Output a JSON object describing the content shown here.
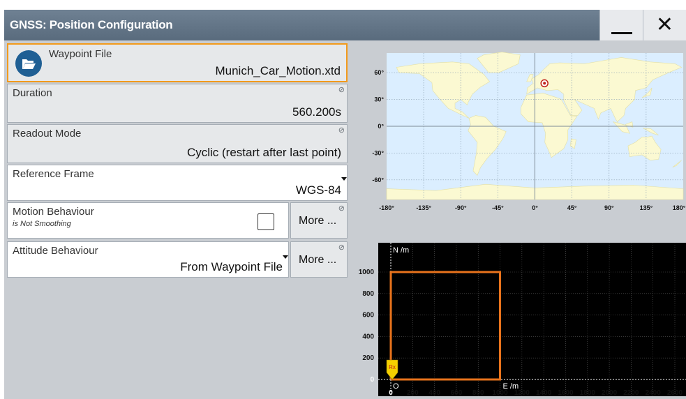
{
  "window": {
    "title": "GNSS: Position Configuration"
  },
  "titlebar": {
    "minimize_icon": "minimize-icon",
    "close_icon": "close-icon",
    "close_glyph": "✕"
  },
  "waypoint": {
    "label": "Waypoint File",
    "value": "Munich_Car_Motion.xtd",
    "icon": "folder-open-icon"
  },
  "duration": {
    "label": "Duration",
    "value": "560.200s",
    "readonly_icon": "read-only-icon"
  },
  "readout_mode": {
    "label": "Readout Mode",
    "value": "Cyclic (restart after last point)",
    "readonly_icon": "read-only-icon"
  },
  "reference_frame": {
    "label": "Reference Frame",
    "value": "WGS-84"
  },
  "motion_behaviour": {
    "label": "Motion Behaviour",
    "sublabel": "is Not Smoothing",
    "checked": false,
    "more_label": "More ..."
  },
  "attitude_behaviour": {
    "label": "Attitude Behaviour",
    "value": "From Waypoint File",
    "more_label": "More ..."
  },
  "colors": {
    "accent": "#f29a1c",
    "titlebar": "#5f7183",
    "ocean": "#dbeeff",
    "land": "#fbf9d2",
    "plot_bg": "#000000",
    "track": "#e8731c"
  },
  "world_map": {
    "lat_ticks": [
      "60°",
      "30°",
      "0°",
      "-30°",
      "-60°"
    ],
    "lon_ticks": [
      "-180°",
      "-135°",
      "-90°",
      "-45°",
      "0°",
      "45°",
      "90°",
      "135°",
      "180°"
    ],
    "marker": {
      "lon": 11.6,
      "lat": 48.1
    }
  },
  "chart_data": {
    "type": "line",
    "title": "",
    "xlabel": "E /m",
    "ylabel": "N /m",
    "origin_label": "O",
    "receiver_label": "Rx",
    "x_ticks": [
      "0",
      "200",
      "400",
      "600",
      "800",
      "1000",
      "1200",
      "1400",
      "1600",
      "1800",
      "2000",
      "2200",
      "2400",
      "2600"
    ],
    "y_ticks": [
      "0",
      "200",
      "400",
      "600",
      "800",
      "1000"
    ],
    "xlim": [
      0,
      2750
    ],
    "ylim": [
      -50,
      1100
    ],
    "grid": true,
    "series": [
      {
        "x": [
          0,
          0,
          1000,
          1000,
          0
        ],
        "y": [
          0,
          1000,
          1000,
          0,
          0
        ]
      }
    ]
  }
}
